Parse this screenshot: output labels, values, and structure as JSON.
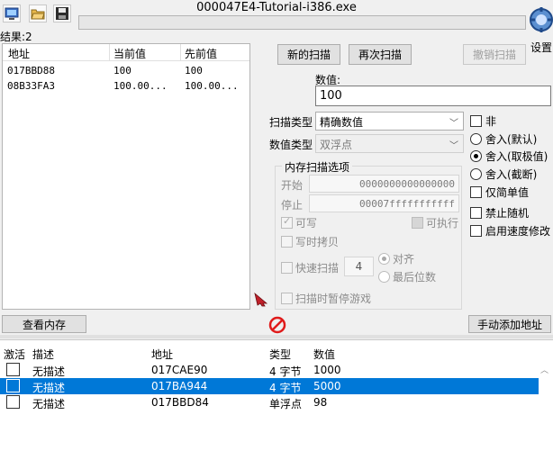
{
  "window": {
    "title": "000047E4-Tutorial-i386.exe"
  },
  "toolbar": {
    "open_process_icon": "monitor-icon",
    "open_file_icon": "folder-open-icon",
    "save_icon": "floppy-disk-icon"
  },
  "settings": {
    "label": "设置"
  },
  "results": {
    "label": "结果:2"
  },
  "found_list": {
    "columns": [
      "地址",
      "当前值",
      "先前值"
    ],
    "rows": [
      {
        "address": "017BBD88",
        "current": "100",
        "previous": "100"
      },
      {
        "address": "08B33FA3",
        "current": "100.00...",
        "previous": "100.00..."
      }
    ]
  },
  "scan_buttons": {
    "first_scan": "新的扫描",
    "next_scan": "再次扫描",
    "undo_scan": "撤销扫描"
  },
  "value": {
    "label": "数值:",
    "value": "100"
  },
  "scan_type": {
    "label": "扫描类型",
    "selected": "精确数值"
  },
  "value_type": {
    "label": "数值类型",
    "selected": "双浮点"
  },
  "right_options": {
    "not_label": "非",
    "round_default": "舍入(默认)",
    "round_extreme": "舍入(取极值)",
    "truncate": "舍入(截断)",
    "simple_values": "仅简单值",
    "unrandomizer": "禁止随机",
    "speedhack": "启用速度修改"
  },
  "memory_options": {
    "title": "内存扫描选项",
    "start_label": "开始",
    "start_value": "0000000000000000",
    "stop_label": "停止",
    "stop_value": "00007fffffffffff",
    "writable": "可写",
    "executable": "可执行",
    "copy_on_write": "写时拷贝",
    "fast_scan": "快速扫描",
    "fast_scan_value": "4",
    "alignment": "对齐",
    "last_digits": "最后位数",
    "pause_game": "扫描时暂停游戏"
  },
  "bottom_buttons": {
    "memory_view": "查看内存",
    "add_address": "手动添加地址"
  },
  "address_list": {
    "columns": [
      "激活",
      "描述",
      "地址",
      "类型",
      "数值"
    ],
    "rows": [
      {
        "description": "无描述",
        "address": "017CAE90",
        "type": "4 字节",
        "value": "1000",
        "selected": false
      },
      {
        "description": "无描述",
        "address": "017BA944",
        "type": "4 字节",
        "value": "5000",
        "selected": true
      },
      {
        "description": "无描述",
        "address": "017BBD84",
        "type": "单浮点",
        "value": "98",
        "selected": false
      }
    ]
  },
  "colors": {
    "selection": "#0078d7",
    "window_bg": "#f0f0f0"
  }
}
